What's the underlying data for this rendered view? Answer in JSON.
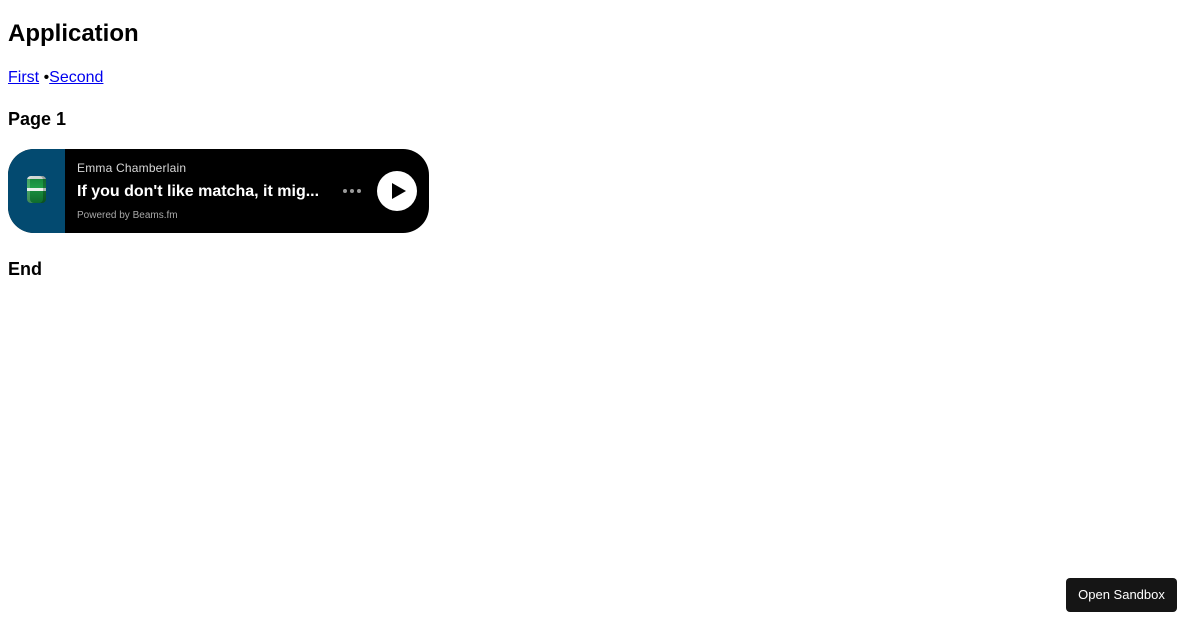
{
  "app": {
    "title": "Application"
  },
  "nav": {
    "links": [
      {
        "label": "First"
      },
      {
        "label": "Second"
      }
    ],
    "separator": "•"
  },
  "page": {
    "heading": "Page 1",
    "end_heading": "End"
  },
  "player": {
    "artist": "Emma Chamberlain",
    "episode_title": "If you don't like matcha, it mig...",
    "powered_by": "Powered by Beams.fm",
    "artwork_icon": "matcha-can-artwork",
    "more_icon": "more-dots-icon",
    "play_icon": "play-icon",
    "colors": {
      "background": "#000000",
      "artwork_background": "#034a70"
    }
  },
  "sandbox": {
    "label": "Open Sandbox"
  }
}
